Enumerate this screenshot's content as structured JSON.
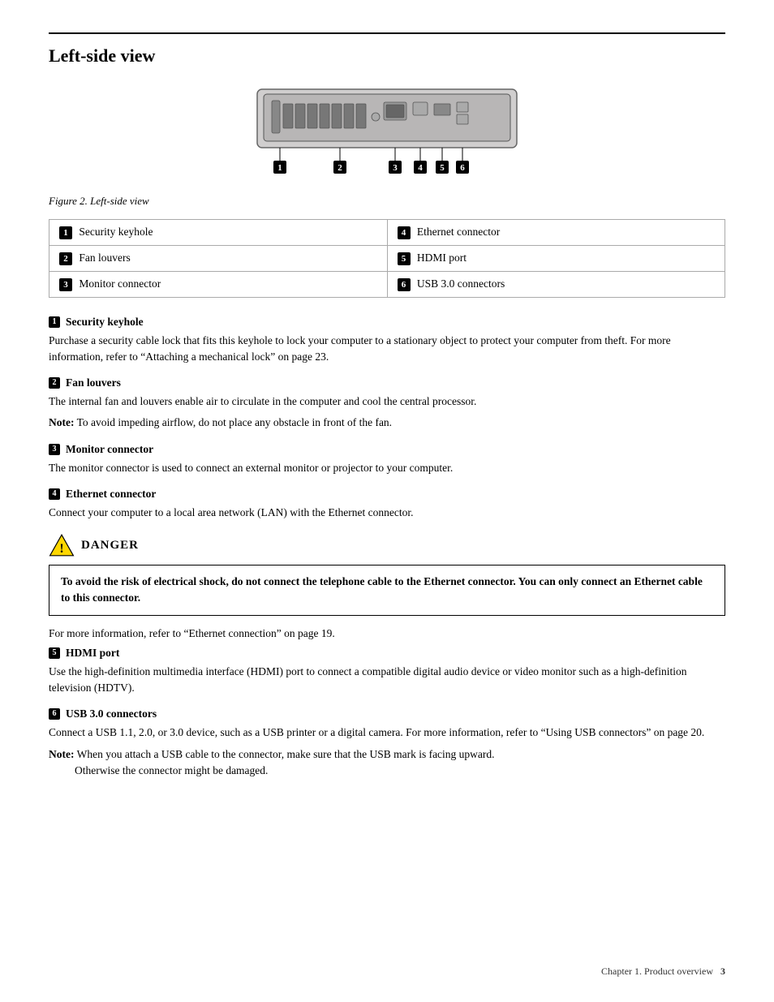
{
  "page": {
    "title": "Left-side view",
    "figure_caption": "Figure 2. Left-side view",
    "footer": "Chapter 1. Product overview",
    "footer_page": "3"
  },
  "table": {
    "rows": [
      {
        "left_badge": "1",
        "left_label": "Security keyhole",
        "right_badge": "4",
        "right_label": "Ethernet connector"
      },
      {
        "left_badge": "2",
        "left_label": "Fan louvers",
        "right_badge": "5",
        "right_label": "HDMI port"
      },
      {
        "left_badge": "3",
        "left_label": "Monitor connector",
        "right_badge": "6",
        "right_label": "USB 3.0 connectors"
      }
    ]
  },
  "sections": [
    {
      "id": "security-keyhole",
      "badge": "1",
      "heading": "Security keyhole",
      "body": "Purchase a security cable lock that fits this keyhole to lock your computer to a stationary object to protect your computer from theft. For more information, refer to “Attaching a mechanical lock” on page 23.",
      "note": null
    },
    {
      "id": "fan-louvers",
      "badge": "2",
      "heading": "Fan louvers",
      "body": "The internal fan and louvers enable air to circulate in the computer and cool the central processor.",
      "note": "To avoid impeding airflow, do not place any obstacle in front of the fan."
    },
    {
      "id": "monitor-connector",
      "badge": "3",
      "heading": "Monitor connector",
      "body": "The monitor connector is used to connect an external monitor or projector to your computer.",
      "note": null
    },
    {
      "id": "ethernet-connector",
      "badge": "4",
      "heading": "Ethernet connector",
      "body": "Connect your computer to a local area network (LAN) with the Ethernet connector.",
      "note": null
    }
  ],
  "danger": {
    "label": "DANGER",
    "box_text": "To avoid the risk of electrical shock, do not connect the telephone cable to the Ethernet connector. You can only connect an Ethernet cable to this connector.",
    "followup": "For more information, refer to “Ethernet connection” on page 19."
  },
  "sections2": [
    {
      "id": "hdmi-port",
      "badge": "5",
      "heading": "HDMI port",
      "body": "Use the high-definition multimedia interface (HDMI) port to connect a compatible digital audio device or video monitor such as a high-definition television (HDTV).",
      "note": null
    },
    {
      "id": "usb-connectors",
      "badge": "6",
      "heading": "USB 3.0 connectors",
      "body": "Connect a USB 1.1, 2.0, or 3.0 device, such as a USB printer or a digital camera. For more information, refer to “Using USB connectors” on page 20.",
      "note": "When you attach a USB cable to the connector, make sure that the USB mark is facing upward.",
      "note2": "Otherwise the connector might be damaged."
    }
  ]
}
